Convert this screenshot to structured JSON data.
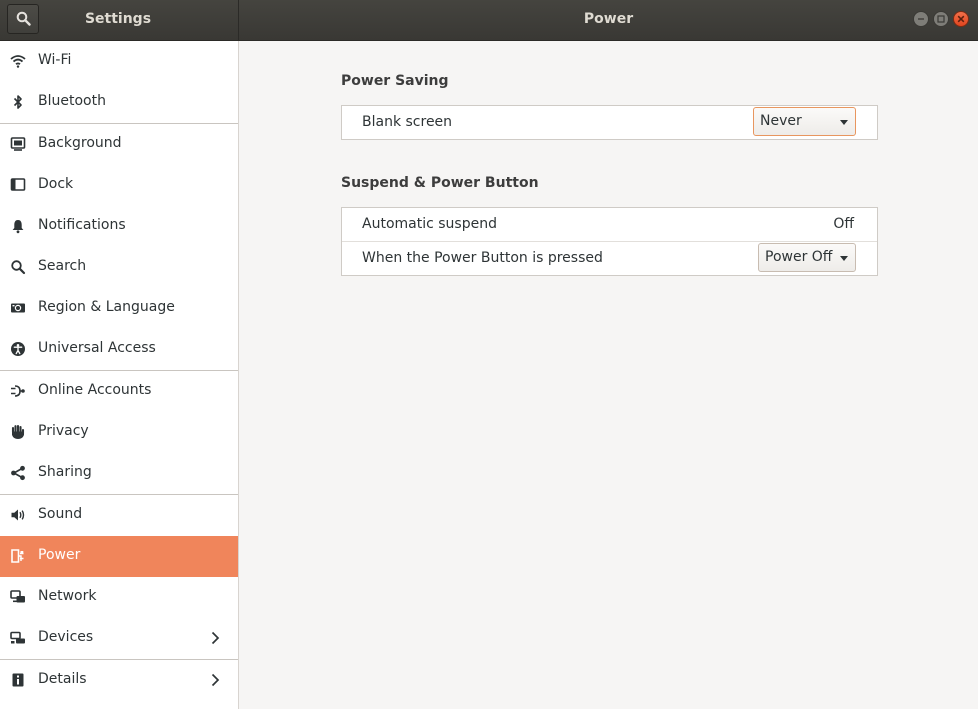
{
  "header": {
    "sidebar_title": "Settings",
    "main_title": "Power"
  },
  "sidebar": {
    "items": [
      {
        "label": "Wi-Fi",
        "icon": "wifi-icon"
      },
      {
        "label": "Bluetooth",
        "icon": "bluetooth-icon"
      },
      {
        "label": "Background",
        "icon": "background-icon"
      },
      {
        "label": "Dock",
        "icon": "dock-icon"
      },
      {
        "label": "Notifications",
        "icon": "bell-icon"
      },
      {
        "label": "Search",
        "icon": "search-icon"
      },
      {
        "label": "Region & Language",
        "icon": "region-icon"
      },
      {
        "label": "Universal Access",
        "icon": "accessibility-icon"
      },
      {
        "label": "Online Accounts",
        "icon": "online-accounts-icon"
      },
      {
        "label": "Privacy",
        "icon": "hand-icon"
      },
      {
        "label": "Sharing",
        "icon": "share-icon"
      },
      {
        "label": "Sound",
        "icon": "speaker-icon"
      },
      {
        "label": "Power",
        "icon": "power-icon",
        "selected": true
      },
      {
        "label": "Network",
        "icon": "network-icon"
      },
      {
        "label": "Devices",
        "icon": "devices-icon",
        "has_submenu": true
      },
      {
        "label": "Details",
        "icon": "details-icon",
        "has_submenu": true
      }
    ]
  },
  "power_saving": {
    "title": "Power Saving",
    "blank_screen_label": "Blank screen",
    "blank_screen_value": "Never"
  },
  "suspend": {
    "title": "Suspend & Power Button",
    "auto_suspend_label": "Automatic suspend",
    "auto_suspend_value": "Off",
    "power_button_label": "When the Power Button is pressed",
    "power_button_value": "Power Off"
  },
  "colors": {
    "accent": "#f0855b",
    "headerbar": "#3d3c38",
    "close_button": "#e9552f"
  }
}
